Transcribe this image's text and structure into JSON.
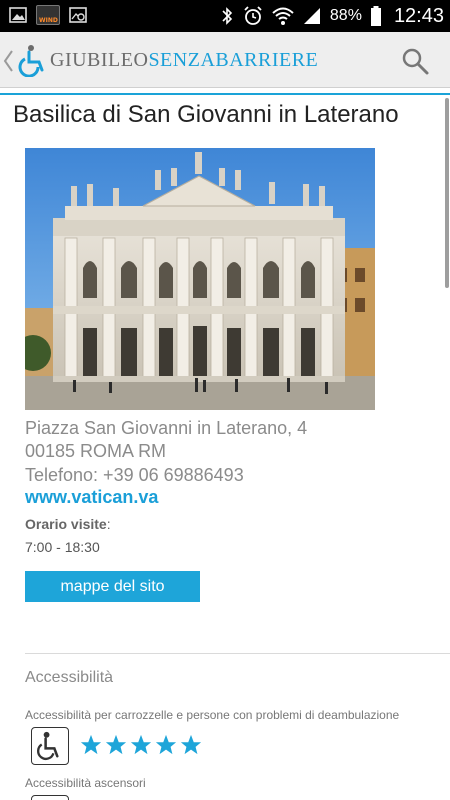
{
  "status_bar": {
    "carrier_icon_label": "WIND",
    "battery_percent": "88%",
    "time": "12:43",
    "icons": [
      "image-icon",
      "wind-carrier-icon",
      "screenshot-icon",
      "bluetooth-icon",
      "alarm-icon",
      "wifi-icon",
      "signal-icon",
      "battery-icon"
    ]
  },
  "app_bar": {
    "logo_text_part1": "GIUBILEO",
    "logo_text_part2": "SENZABARRIERE",
    "colors": {
      "accent": "#1a9fd8",
      "logo_gray": "#6c6c6c"
    }
  },
  "place": {
    "title": "Basilica di San Giovanni in Laterano",
    "address_line1": "Piazza San Giovanni in Laterano, 4",
    "address_line2": "00185 ROMA RM",
    "phone": "Telefono: +39 06 69886493",
    "website": "www.vatican.va",
    "hours_label": "Orario visite",
    "hours_suffix": ":",
    "hours_value": "7:00 - 18:30",
    "map_button": "mappe del sito"
  },
  "accessibility": {
    "section_title": "Accessibilità",
    "items": [
      {
        "label": "Accessibilità per carrozzelle e persone con problemi di deambulazione",
        "icon": "wheelchair-icon",
        "rating": 5,
        "max": 5
      },
      {
        "label": "Accessibilità ascensori",
        "icon": "elevator-icon"
      }
    ]
  }
}
